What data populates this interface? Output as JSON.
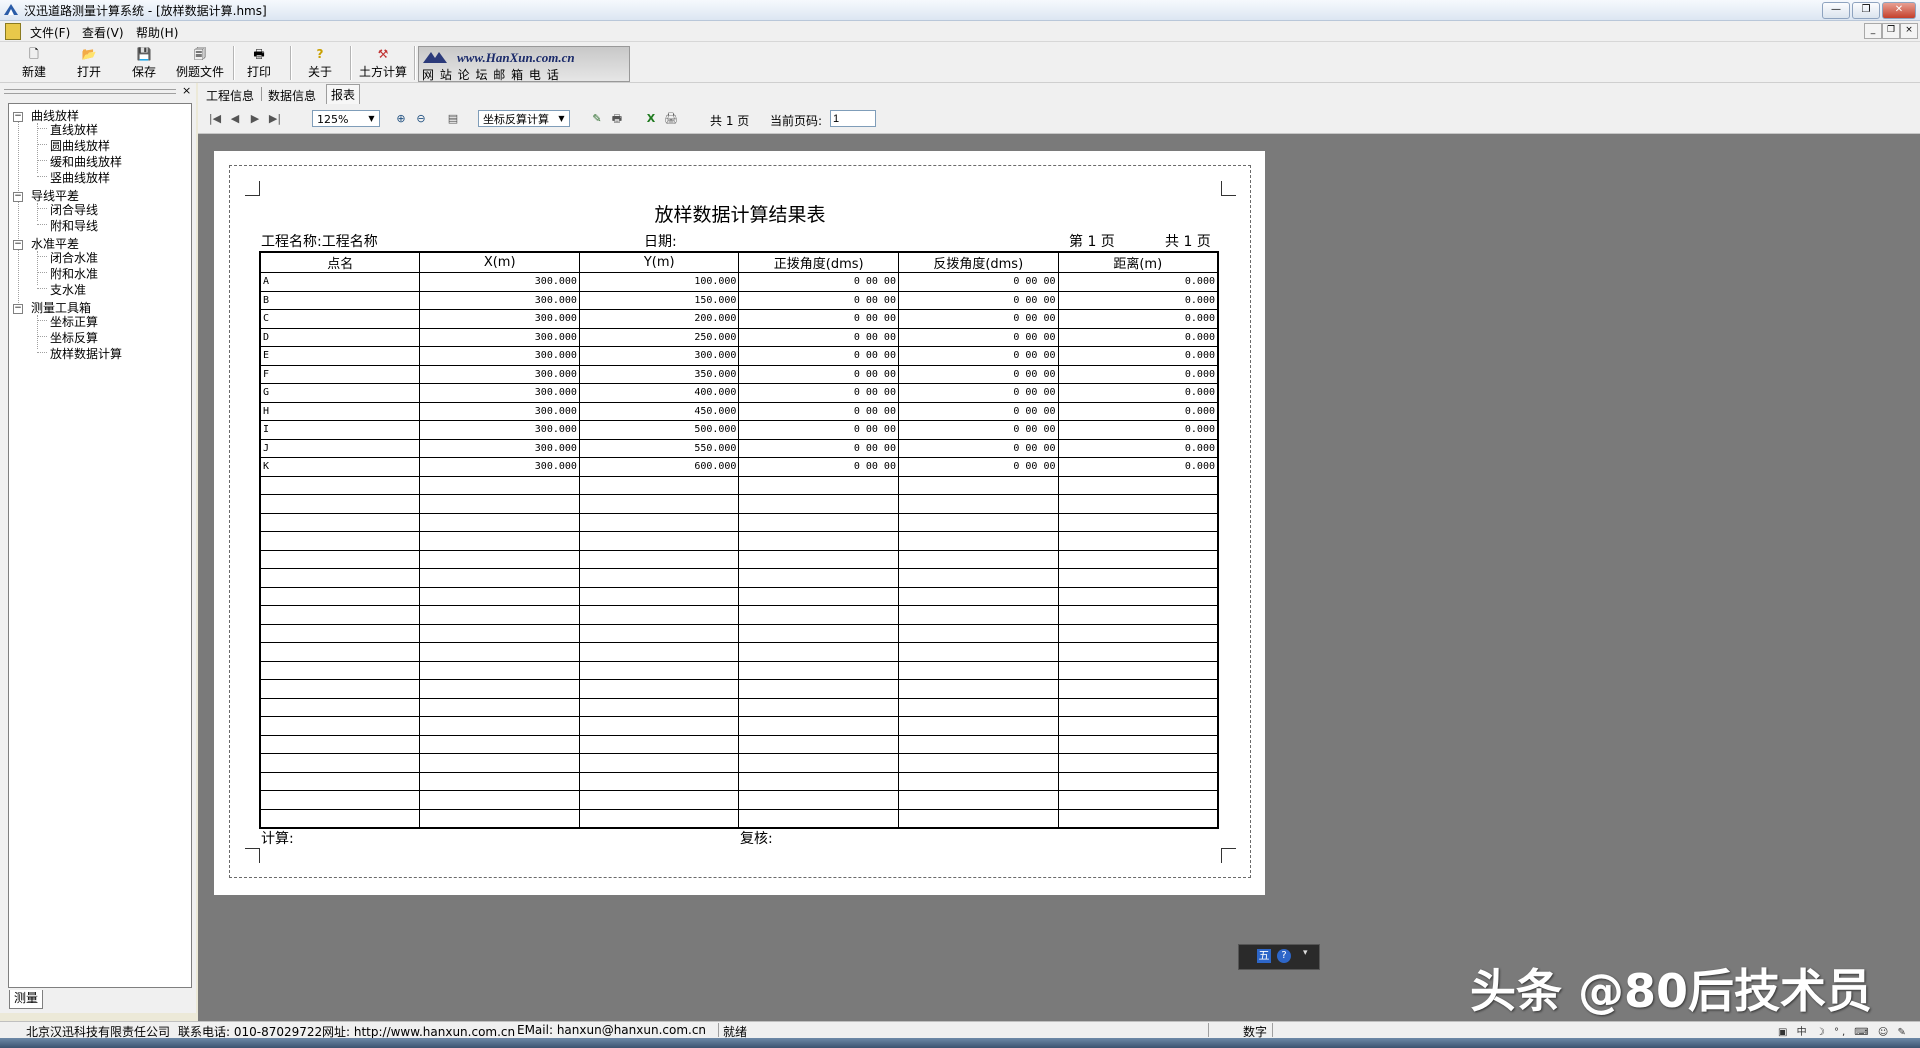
{
  "window": {
    "title": "汉迅道路测量计算系统 - [放样数据计算.hms]",
    "btn_min": "—",
    "btn_max": "❐",
    "btn_close": "✕"
  },
  "menu": [
    "文件(F)",
    "查看(V)",
    "帮助(H)"
  ],
  "toolbar": {
    "new": "新建",
    "open": "打开",
    "save": "保存",
    "example": "例题文件",
    "print": "打印",
    "about": "关于",
    "earthwork": "土方计算",
    "banner_url": "www.HanXun.com.cn",
    "banner_links": "网 站  论 坛  邮 箱  电 话"
  },
  "tree": {
    "groups": [
      {
        "label": "曲线放样",
        "items": [
          "直线放样",
          "圆曲线放样",
          "缓和曲线放样",
          "竖曲线放样"
        ]
      },
      {
        "label": "导线平差",
        "items": [
          "闭合导线",
          "附和导线"
        ]
      },
      {
        "label": "水准平差",
        "items": [
          "闭合水准",
          "附和水准",
          "支水准"
        ]
      },
      {
        "label": "测量工具箱",
        "items": [
          "坐标正算",
          "坐标反算",
          "放样数据计算"
        ]
      }
    ],
    "bottom_tab": "测量"
  },
  "tabs": [
    "工程信息",
    "数据信息",
    "报表"
  ],
  "report_toolbar": {
    "zoom": "125%",
    "mode": "坐标反算计算",
    "total_pages": "共 1 页",
    "current_page_label": "当前页码:",
    "current_page_value": "1"
  },
  "report": {
    "title": "放样数据计算结果表",
    "project_label": "工程名称:工程名称",
    "date_label": "日期:",
    "page_label": "第 1 页",
    "total_label": "共 1 页",
    "columns": [
      "点名",
      "X(m)",
      "Y(m)",
      "正拨角度(dms)",
      "反拨角度(dms)",
      "距离(m)"
    ],
    "rows": [
      [
        "A",
        "300.000",
        "100.000",
        "0 00 00",
        "0 00 00",
        "0.000"
      ],
      [
        "B",
        "300.000",
        "150.000",
        "0 00 00",
        "0 00 00",
        "0.000"
      ],
      [
        "C",
        "300.000",
        "200.000",
        "0 00 00",
        "0 00 00",
        "0.000"
      ],
      [
        "D",
        "300.000",
        "250.000",
        "0 00 00",
        "0 00 00",
        "0.000"
      ],
      [
        "E",
        "300.000",
        "300.000",
        "0 00 00",
        "0 00 00",
        "0.000"
      ],
      [
        "F",
        "300.000",
        "350.000",
        "0 00 00",
        "0 00 00",
        "0.000"
      ],
      [
        "G",
        "300.000",
        "400.000",
        "0 00 00",
        "0 00 00",
        "0.000"
      ],
      [
        "H",
        "300.000",
        "450.000",
        "0 00 00",
        "0 00 00",
        "0.000"
      ],
      [
        "I",
        "300.000",
        "500.000",
        "0 00 00",
        "0 00 00",
        "0.000"
      ],
      [
        "J",
        "300.000",
        "550.000",
        "0 00 00",
        "0 00 00",
        "0.000"
      ],
      [
        "K",
        "300.000",
        "600.000",
        "0 00 00",
        "0 00 00",
        "0.000"
      ]
    ],
    "empty_rows": 19,
    "calc_label": "计算:",
    "review_label": "复核:"
  },
  "statusbar": {
    "company": "北京汉迅科技有限责任公司",
    "phone": "联系电话: 010-87029722",
    "website": "网址: http://www.hanxun.com.cn",
    "email": "EMail: hanxun@hanxun.com.cn",
    "status": "就绪",
    "numlock": "数字"
  },
  "ime": {
    "label": "五"
  },
  "watermark": "头条 @80后技术员"
}
